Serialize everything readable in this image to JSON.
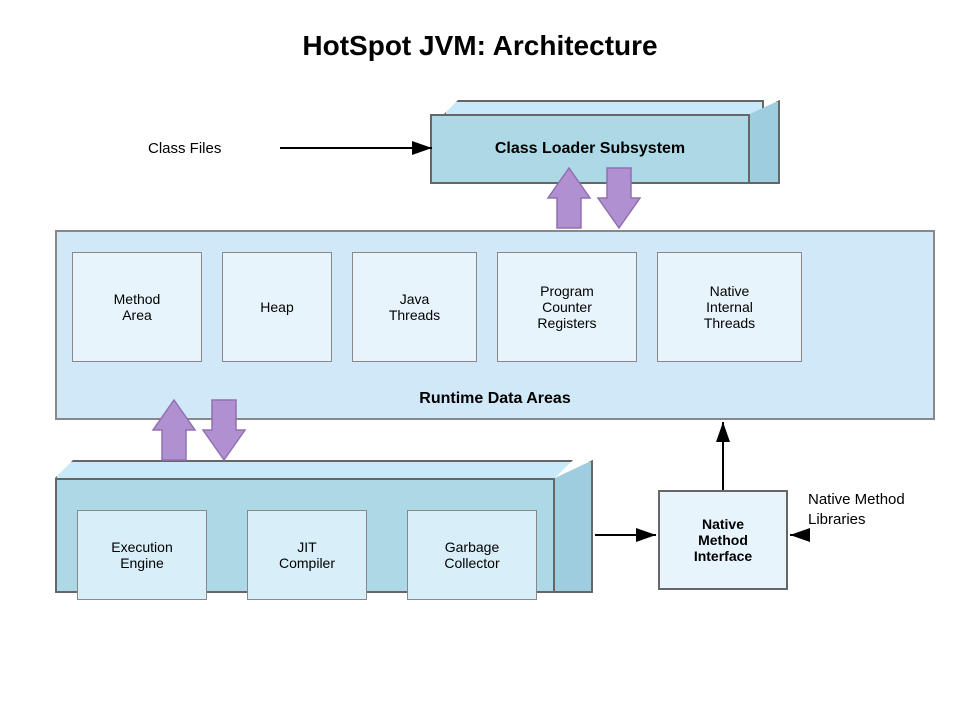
{
  "title": "HotSpot JVM: Architecture",
  "classFiles": {
    "label": "Class Files"
  },
  "classLoader": {
    "label": "Class Loader Subsystem"
  },
  "runtime": {
    "title": "Runtime Data Areas",
    "boxes": [
      {
        "id": "method-area",
        "label": "Method\nArea"
      },
      {
        "id": "heap",
        "label": "Heap"
      },
      {
        "id": "java-threads",
        "label": "Java\nThreads"
      },
      {
        "id": "program-counter",
        "label": "Program\nCounter\nRegisters"
      },
      {
        "id": "native-internal",
        "label": "Native\nInternal\nThreads"
      }
    ]
  },
  "execEngine": {
    "boxes": [
      {
        "id": "execution-engine",
        "label": "Execution\nEngine"
      },
      {
        "id": "jit-compiler",
        "label": "JIT\nCompiler"
      },
      {
        "id": "garbage-collector",
        "label": "Garbage\nCollector"
      }
    ]
  },
  "nativeMethodInterface": {
    "label": "Native\nMethod\nInterface"
  },
  "nativeMethodLibraries": {
    "label": "Native\nMethod\nLibraries"
  }
}
